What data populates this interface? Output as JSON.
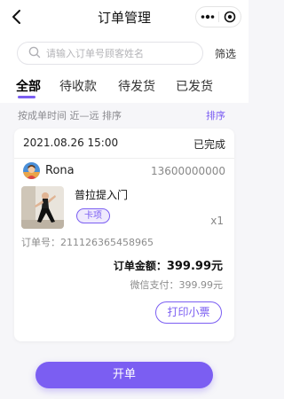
{
  "header": {
    "title": "订单管理"
  },
  "search": {
    "placeholder": "请输入订单号顾客姓名",
    "value": "",
    "filter_label": "筛选"
  },
  "tabs": [
    {
      "label": "全部",
      "active": true
    },
    {
      "label": "待收款",
      "active": false
    },
    {
      "label": "待发货",
      "active": false
    },
    {
      "label": "已发货",
      "active": false
    }
  ],
  "sort": {
    "description": "按成单时间 近—远 排序",
    "button_label": "排序"
  },
  "order": {
    "date": "2021.08.26 15:00",
    "status": "已完成",
    "customer_name": "Rona",
    "customer_phone": "13600000000",
    "product_name": "普拉提入门",
    "product_tag": "卡项",
    "quantity": "x1",
    "order_no_label": "订单号：",
    "order_no": "211126365458965",
    "total_label": "订单金额：",
    "total_amount": "399.99元",
    "payment_label": "微信支付：",
    "payment_amount": "399.99元",
    "print_label": "打印小票"
  },
  "footer": {
    "open_label": "开单"
  },
  "colors": {
    "accent": "#7b5ef2",
    "background": "#f6f6f9"
  }
}
